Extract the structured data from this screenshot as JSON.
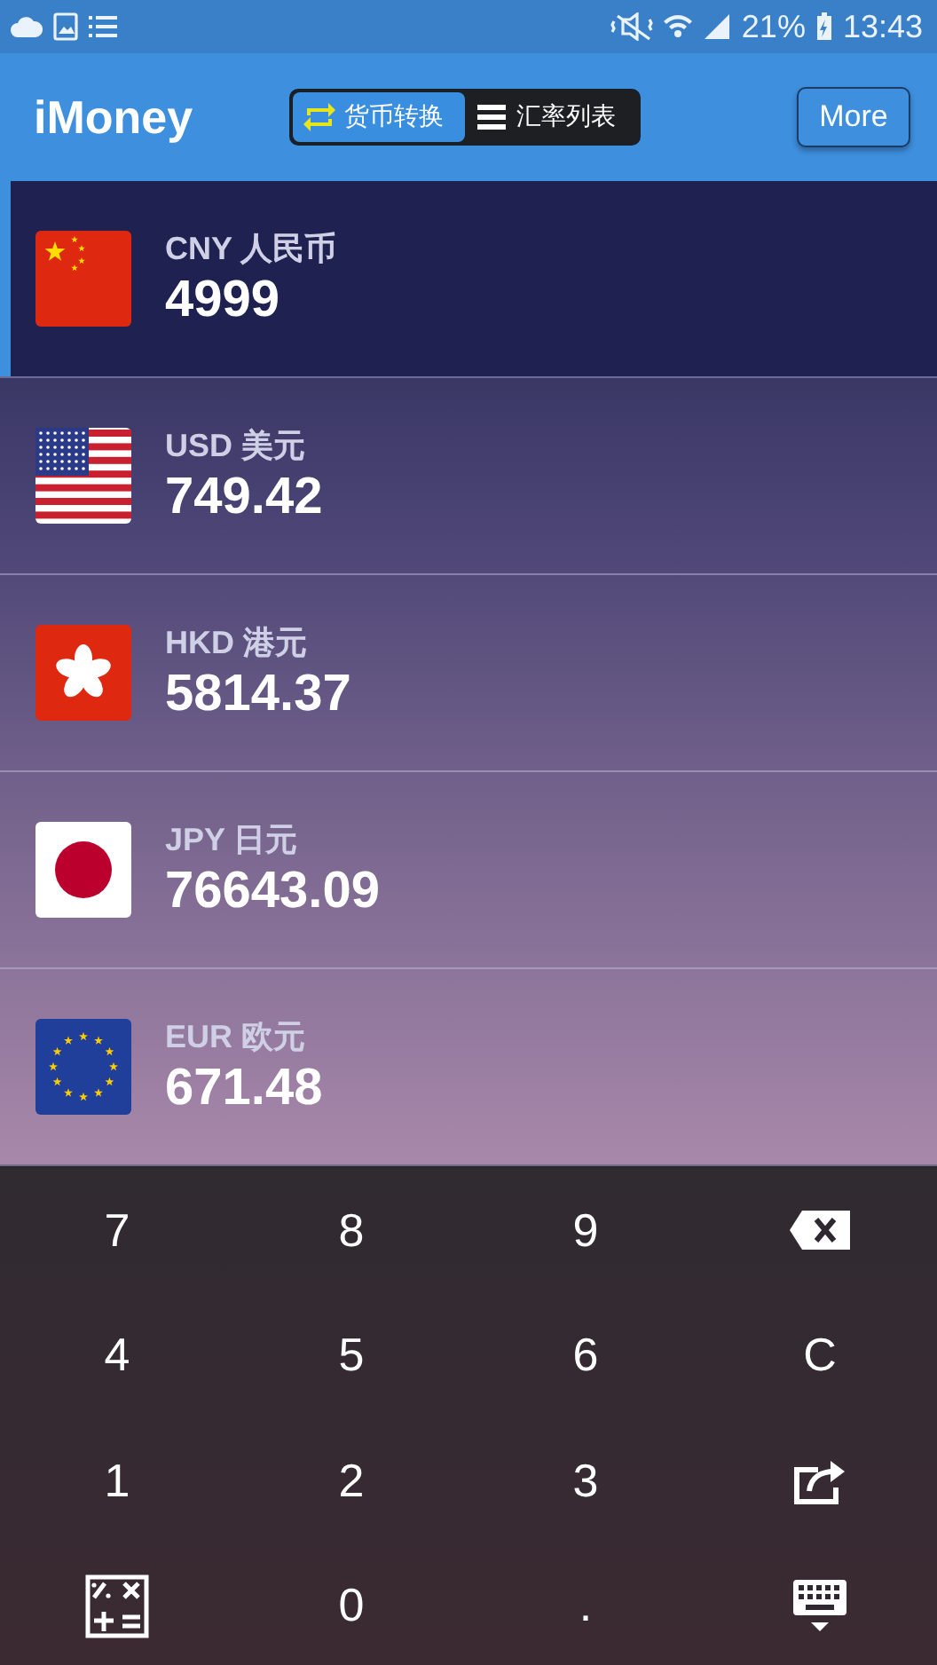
{
  "status_bar": {
    "battery": "21%",
    "time": "13:43"
  },
  "app_bar": {
    "title": "iMoney",
    "tabs": [
      {
        "label": "货币转换",
        "kind": "swap",
        "selected": true
      },
      {
        "label": "汇率列表",
        "kind": "list",
        "selected": false
      }
    ],
    "more_button": "More"
  },
  "currencies": [
    {
      "code": "CNY 人民币",
      "amount": "4999",
      "kind": "cn",
      "selected": true
    },
    {
      "code": "USD 美元",
      "amount": "749.42",
      "kind": "us",
      "selected": false
    },
    {
      "code": "HKD 港元",
      "amount": "5814.37",
      "kind": "hk",
      "selected": false
    },
    {
      "code": "JPY 日元",
      "amount": "76643.09",
      "kind": "jp",
      "selected": false
    },
    {
      "code": "EUR 欧元",
      "amount": "671.48",
      "kind": "eu",
      "selected": false
    }
  ],
  "keypad": [
    {
      "kind": "digit",
      "label": "7"
    },
    {
      "kind": "digit",
      "label": "8"
    },
    {
      "kind": "digit",
      "label": "9"
    },
    {
      "kind": "backspace"
    },
    {
      "kind": "digit",
      "label": "4"
    },
    {
      "kind": "digit",
      "label": "5"
    },
    {
      "kind": "digit",
      "label": "6"
    },
    {
      "kind": "digit",
      "label": "C"
    },
    {
      "kind": "digit",
      "label": "1"
    },
    {
      "kind": "digit",
      "label": "2"
    },
    {
      "kind": "digit",
      "label": "3"
    },
    {
      "kind": "share"
    },
    {
      "kind": "calculator"
    },
    {
      "kind": "digit",
      "label": "0"
    },
    {
      "kind": "digit",
      "label": "."
    },
    {
      "kind": "keyboard"
    }
  ]
}
